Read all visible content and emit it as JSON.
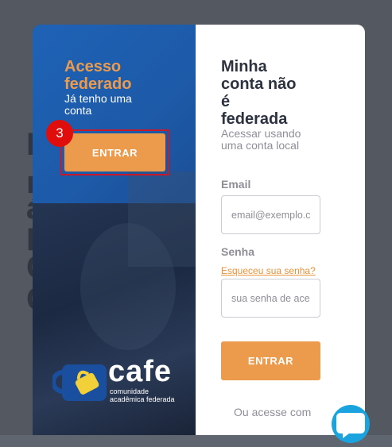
{
  "federated": {
    "title_line1": "Acesso",
    "title_line2": "federado",
    "subtitle_line1": "Já tenho uma",
    "subtitle_line2": "conta",
    "enter_label": "ENTRAR",
    "step_badge": "3"
  },
  "logo": {
    "word": "cafe",
    "tagline_line1": "comunidade",
    "tagline_line2": "acadêmica federada"
  },
  "local": {
    "title_line1": "Minha",
    "title_line2": "conta não",
    "title_line3": "é",
    "title_line4": "federada",
    "subtitle_line1": "Acessar usando",
    "subtitle_line2": "uma conta local",
    "email_label": "Email",
    "email_placeholder": "email@exemplo.com",
    "senha_label": "Senha",
    "forgot_label": "Esqueceu sua senha?",
    "senha_placeholder": "sua senha de acesso",
    "enter_label": "ENTRAR",
    "alt_access": "Ou acesse com"
  },
  "background_letters": [
    "I",
    "n",
    "á",
    "P",
    "C",
    "C"
  ],
  "colors": {
    "accent_orange": "#ec9a4b",
    "federated_blue": "#1f62b6",
    "highlight_red": "#c8182a",
    "chat_blue": "#1aa3de"
  },
  "icons": {
    "logo_mug": "coffee-mug-icon",
    "chat": "chat-bubble-icon"
  }
}
